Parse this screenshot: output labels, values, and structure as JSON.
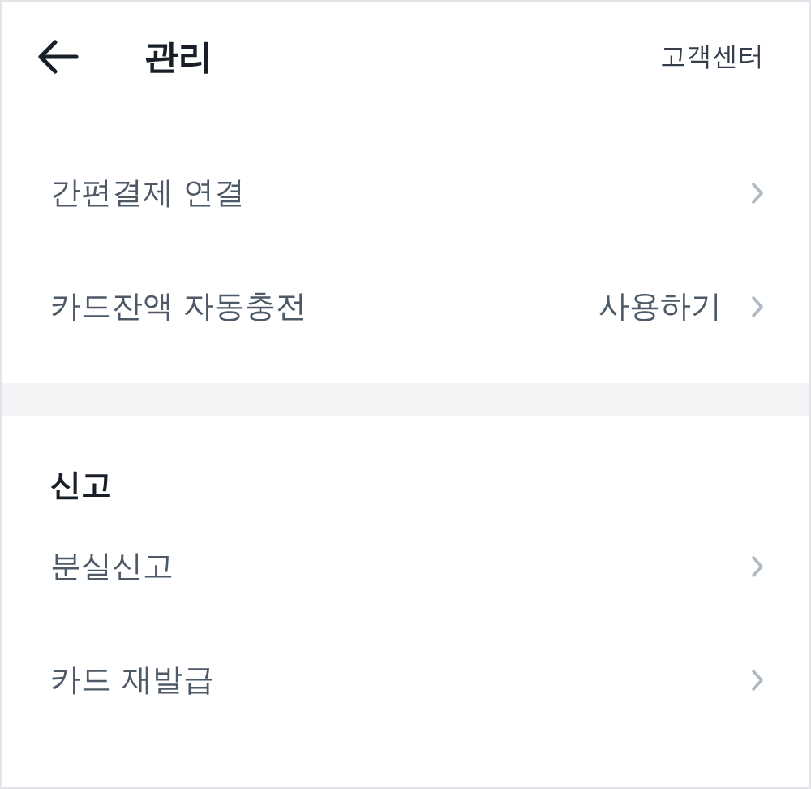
{
  "header": {
    "title": "관리",
    "action": "고객센터"
  },
  "groups": [
    {
      "items": [
        {
          "label": "간편결제 연결"
        },
        {
          "label": "카드잔액 자동충전",
          "value": "사용하기"
        }
      ]
    },
    {
      "title": "신고",
      "items": [
        {
          "label": "분실신고"
        },
        {
          "label": "카드 재발급"
        }
      ]
    }
  ]
}
